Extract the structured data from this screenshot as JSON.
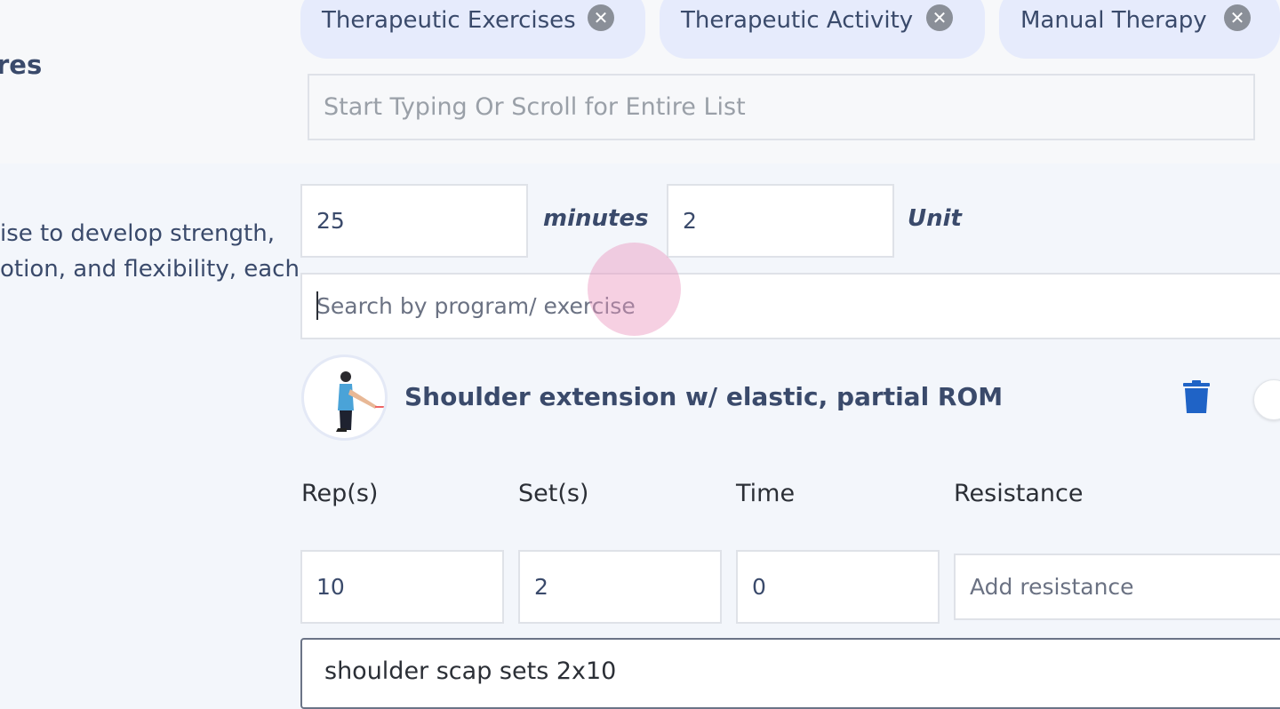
{
  "section": {
    "heading_fragment": "res"
  },
  "procedures": {
    "chips": [
      {
        "label": "Therapeutic Exercises"
      },
      {
        "label": "Therapeutic Activity"
      },
      {
        "label": "Manual Therapy"
      }
    ],
    "search_placeholder": "Start Typing Or Scroll for Entire List"
  },
  "procedure_detail": {
    "description_line1": "ise to develop strength,",
    "description_line2": "otion, and flexibility, each",
    "minutes_value": "25",
    "minutes_label": "minutes",
    "units_value": "2",
    "units_label": "Unit",
    "exercise_search_placeholder": "Search by program/ exercise"
  },
  "exercise": {
    "title": "Shoulder extension w/ elastic, partial ROM",
    "columns": [
      "Rep(s)",
      "Set(s)",
      "Time",
      "Resistance"
    ],
    "reps": "10",
    "sets": "2",
    "time": "0",
    "resistance_placeholder": "Add resistance",
    "notes": "shoulder scap sets 2x10"
  },
  "colors": {
    "chip_bg": "#e6ebfc",
    "text": "#3a4a6b",
    "trash": "#1f63c6",
    "touch_indicator": "#ec96be"
  },
  "icons": [
    "close-icon",
    "trash-icon"
  ]
}
